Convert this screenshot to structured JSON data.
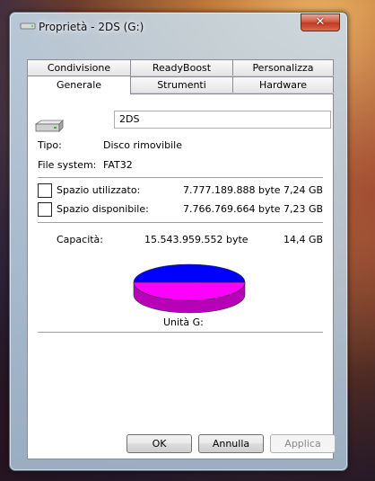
{
  "window": {
    "title": "Proprietà - 2DS (G:)",
    "close_symbol": "✕"
  },
  "tabs": {
    "row1": [
      "Condivisione",
      "ReadyBoost",
      "Personalizza"
    ],
    "row2": [
      "Generale",
      "Strumenti",
      "Hardware"
    ],
    "active": "Generale"
  },
  "general": {
    "drive_name": "2DS",
    "type_label": "Tipo:",
    "type_value": "Disco rimovibile",
    "fs_label": "File system:",
    "fs_value": "FAT32",
    "used_label": "Spazio utilizzato:",
    "used_bytes": "7.777.189.888 byte",
    "used_gb": "7,24 GB",
    "free_label": "Spazio disponibile:",
    "free_bytes": "7.766.769.664 byte",
    "free_gb": "7,23 GB",
    "capacity_label": "Capacità:",
    "capacity_bytes": "15.543.959.552 byte",
    "capacity_gb": "14,4 GB",
    "drive_label": "Unità G:",
    "used_fraction": 0.5003,
    "used_color": "#0000ff",
    "free_color": "#ff00ff"
  },
  "buttons": {
    "ok": "OK",
    "cancel": "Annulla",
    "apply": "Applica"
  }
}
